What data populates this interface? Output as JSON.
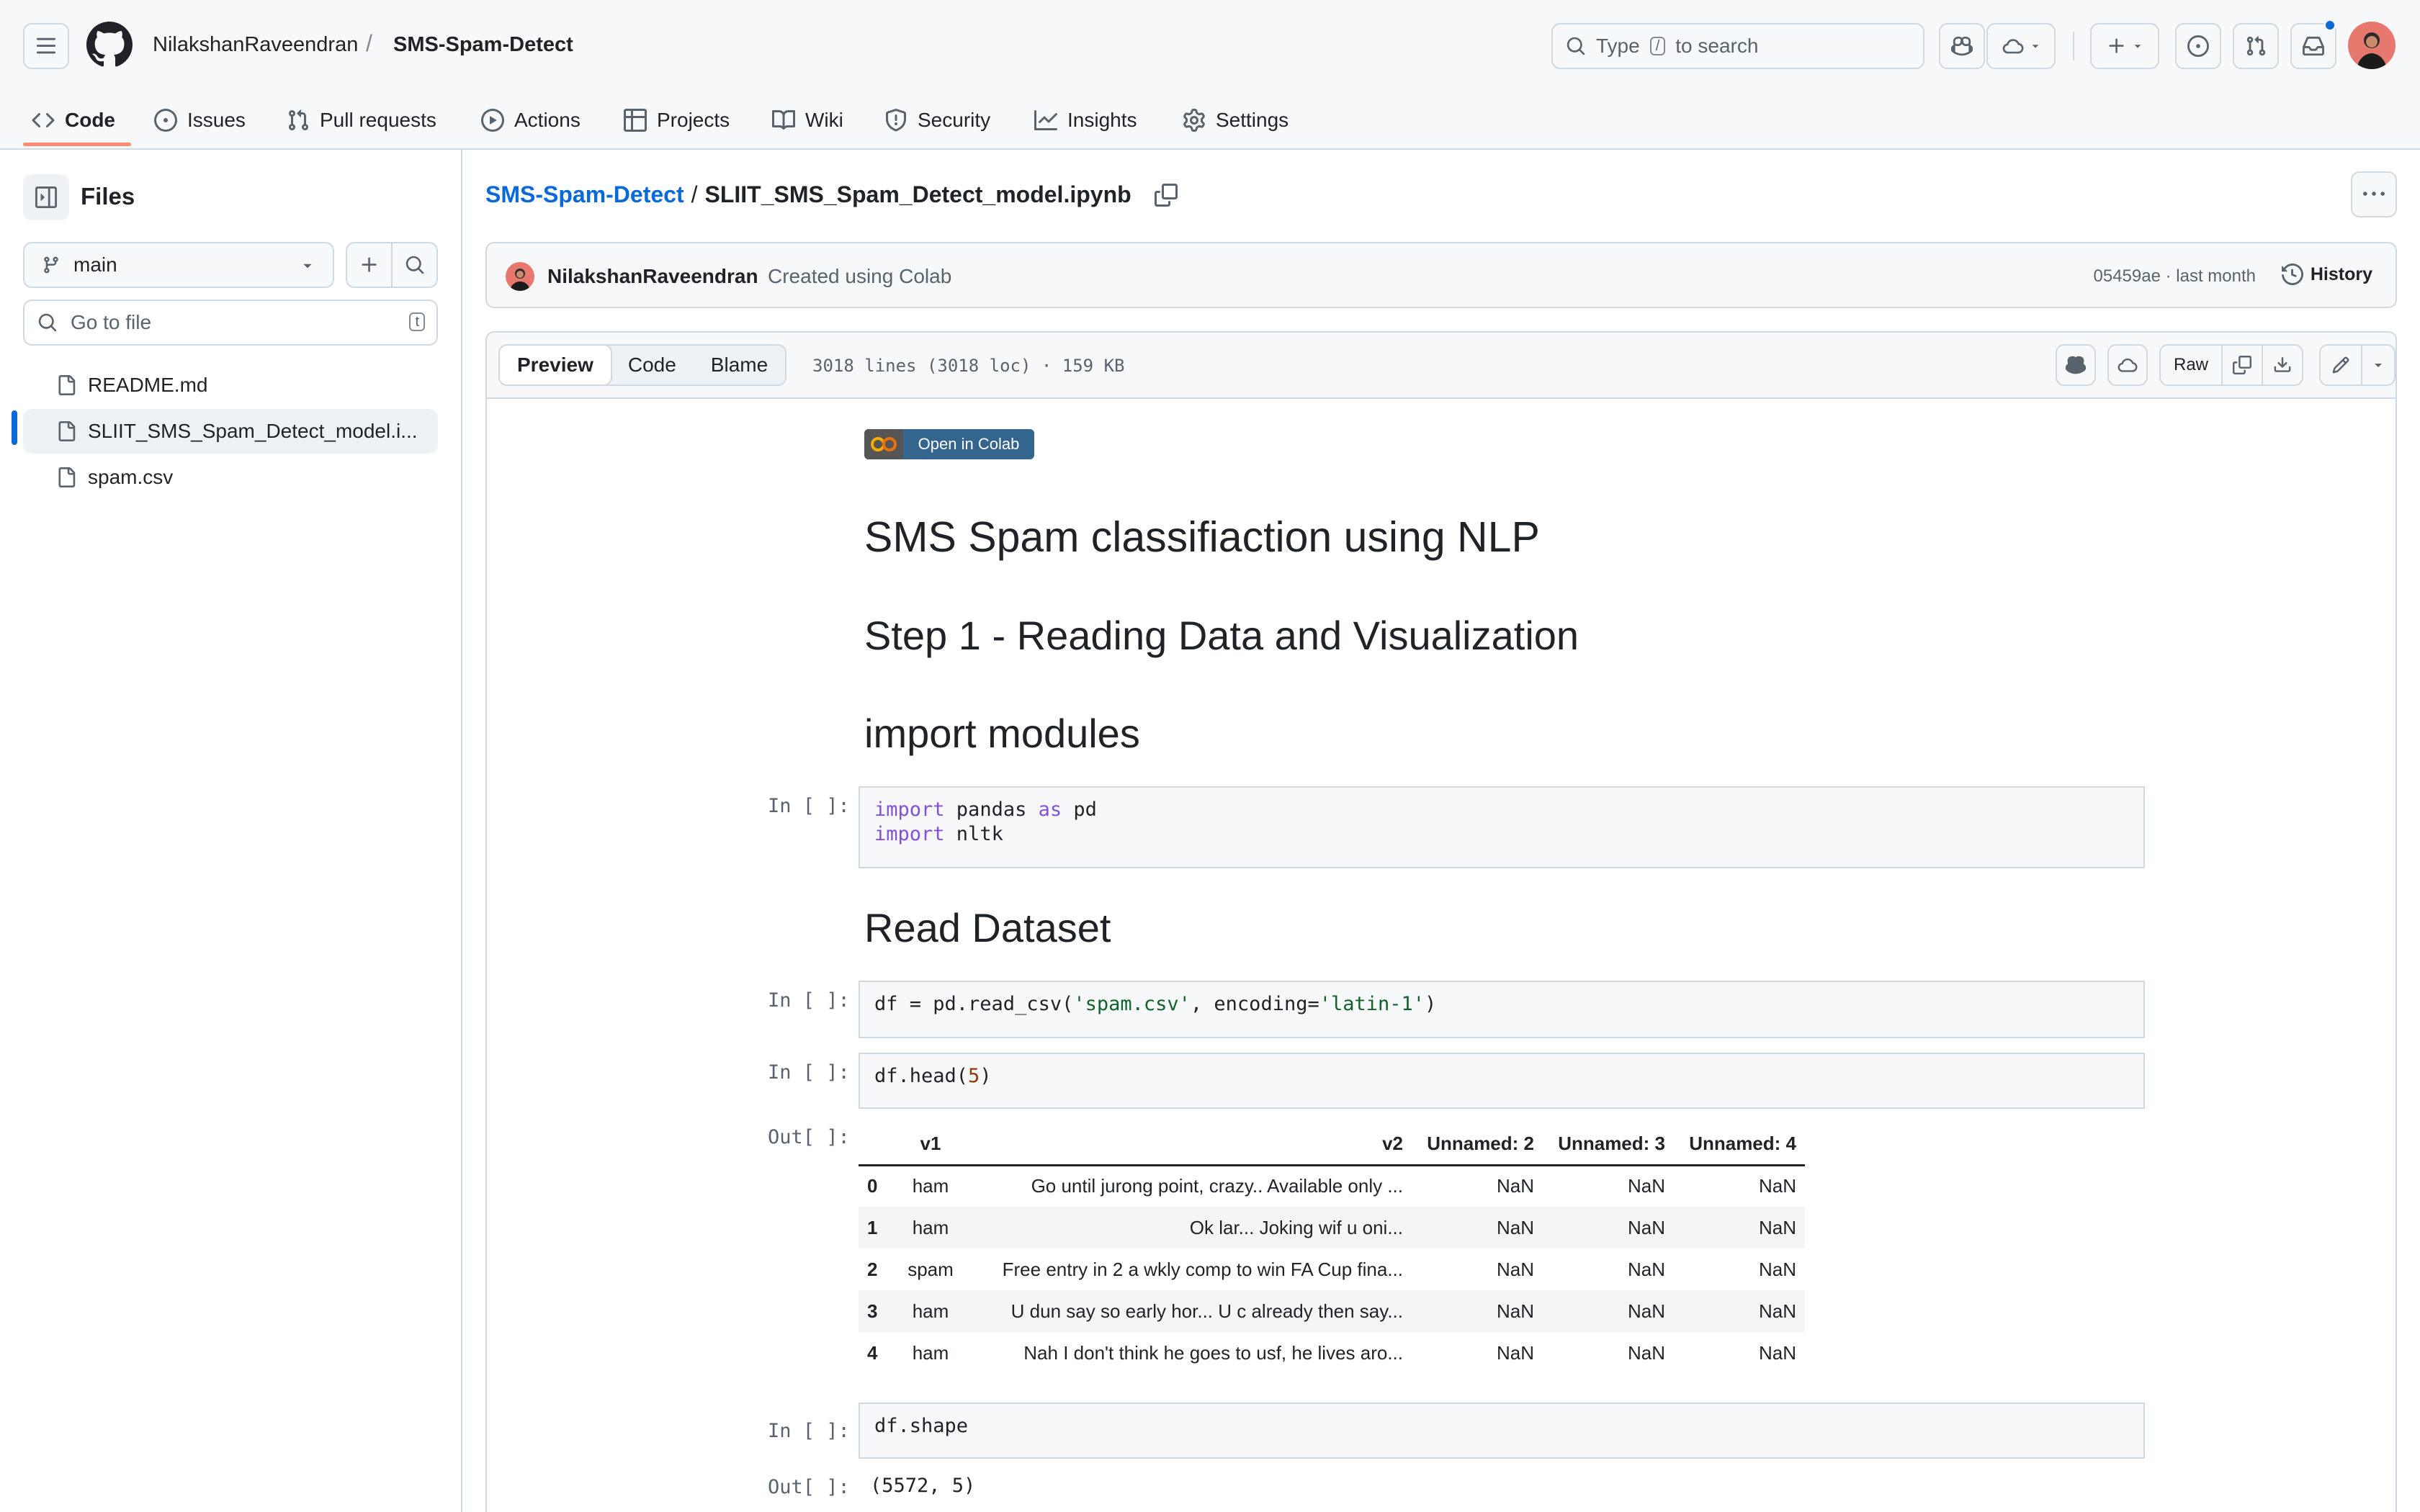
{
  "header": {
    "owner": "NilakshanRaveendran",
    "separator": "/",
    "repo": "SMS-Spam-Detect",
    "search_prefix": "Type",
    "search_key": "/",
    "search_suffix": "to search"
  },
  "repo_nav": [
    {
      "label": "Code",
      "icon": "code-icon"
    },
    {
      "label": "Issues",
      "icon": "issue-icon"
    },
    {
      "label": "Pull requests",
      "icon": "pull-request-icon"
    },
    {
      "label": "Actions",
      "icon": "play-icon"
    },
    {
      "label": "Projects",
      "icon": "table-icon"
    },
    {
      "label": "Wiki",
      "icon": "book-icon"
    },
    {
      "label": "Security",
      "icon": "shield-icon"
    },
    {
      "label": "Insights",
      "icon": "graph-icon"
    },
    {
      "label": "Settings",
      "icon": "gear-icon"
    }
  ],
  "sidebar": {
    "title": "Files",
    "branch": "main",
    "goto_placeholder": "Go to file",
    "goto_key": "t",
    "files": [
      {
        "name": "README.md"
      },
      {
        "name": "SLIIT_SMS_Spam_Detect_model.i..."
      },
      {
        "name": "spam.csv"
      }
    ]
  },
  "file": {
    "repo_link": "SMS-Spam-Detect",
    "path_sep": "/",
    "filename": "SLIIT_SMS_Spam_Detect_model.ipynb",
    "commit_author": "NilakshanRaveendran",
    "commit_message": "Created using Colab",
    "commit_meta": "05459ae · last month",
    "history_label": "History",
    "tabs": [
      "Preview",
      "Code",
      "Blame"
    ],
    "stats": "3018 lines (3018 loc) · 159 KB",
    "raw_label": "Raw"
  },
  "notebook": {
    "colab_badge": "Open in Colab",
    "h1": "SMS Spam classifiaction using NLP",
    "h2_step": "Step 1 - Reading Data and Visualization",
    "h2_import": "import modules",
    "h2_read": "Read Dataset",
    "prompt_in": "In [ ]:",
    "prompt_out": "Out[ ]:",
    "cell1": {
      "kw1": "import",
      "t1": " pandas ",
      "kw2": "as",
      "t2": " pd",
      "kw3": "import",
      "t3": " nltk"
    },
    "cell2": {
      "a": "df = pd.read_csv(",
      "s1": "'spam.csv'",
      "b": ", encoding=",
      "s2": "'latin-1'",
      "c": ")"
    },
    "cell3": {
      "a": "df.head(",
      "n": "5",
      "b": ")"
    },
    "cell4": "df.shape",
    "shape_out": "(5572, 5)",
    "table": {
      "columns": [
        "",
        "v1",
        "v2",
        "Unnamed: 2",
        "Unnamed: 3",
        "Unnamed: 4"
      ],
      "rows": [
        [
          "0",
          "ham",
          "Go until jurong point, crazy.. Available only ...",
          "NaN",
          "NaN",
          "NaN"
        ],
        [
          "1",
          "ham",
          "Ok lar... Joking wif u oni...",
          "NaN",
          "NaN",
          "NaN"
        ],
        [
          "2",
          "spam",
          "Free entry in 2 a wkly comp to win FA Cup fina...",
          "NaN",
          "NaN",
          "NaN"
        ],
        [
          "3",
          "ham",
          "U dun say so early hor... U c already then say...",
          "NaN",
          "NaN",
          "NaN"
        ],
        [
          "4",
          "ham",
          "Nah I don't think he goes to usf, he lives aro...",
          "NaN",
          "NaN",
          "NaN"
        ]
      ]
    }
  },
  "colors": {
    "accent": "#0969da",
    "nav_underline": "#fd8c73",
    "colab_badge": "#33658f"
  }
}
